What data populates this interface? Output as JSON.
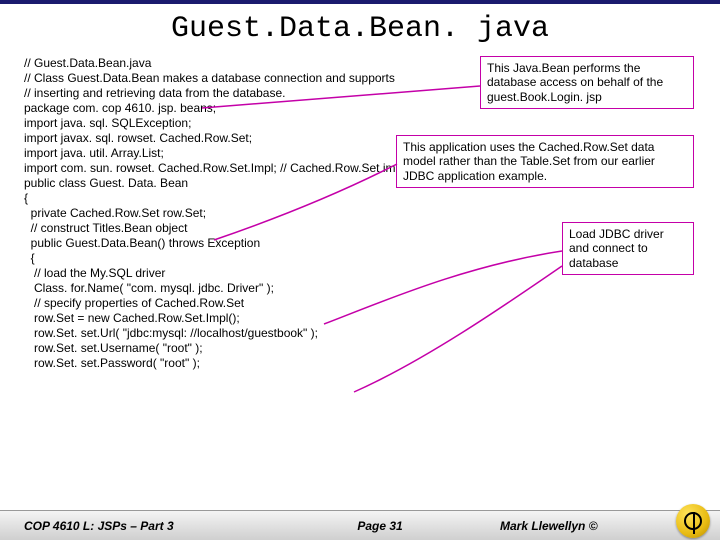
{
  "title": "Guest.Data.Bean. java",
  "code": {
    "l1": "// Guest.Data.Bean.java",
    "l2": "// Class Guest.Data.Bean makes a database connection and supports",
    "l3": "// inserting and retrieving data from the database.",
    "l4": "package com. cop 4610. jsp. beans;",
    "l5": "",
    "l6": "import java. sql. SQLException;",
    "l7": "import javax. sql. rowset. Cached.Row.Set;",
    "l8": "import java. util. Array.List;",
    "l9": "import com. sun. rowset. Cached.Row.Set.Impl; // Cached.Row.Set implementation",
    "l10": "",
    "l11": "public class Guest. Data. Bean",
    "l12": "{",
    "l13": "  private Cached.Row.Set row.Set;",
    "l14": "",
    "l15": "  // construct Titles.Bean object",
    "l16": "  public Guest.Data.Bean() throws Exception",
    "l17": "  {",
    "l18": "   // load the My.SQL driver",
    "l19": "   Class. for.Name( \"com. mysql. jdbc. Driver\" );",
    "l20": "",
    "l21": "   // specify properties of Cached.Row.Set",
    "l22": "   row.Set = new Cached.Row.Set.Impl();",
    "l23": "   row.Set. set.Url( \"jdbc:mysql: //localhost/guestbook\" );",
    "l24": "   row.Set. set.Username( \"root\" );",
    "l25": "   row.Set. set.Password( \"root\" );"
  },
  "callouts": {
    "c1": "This Java.Bean performs the database access on behalf of the guest.Book.Login. jsp",
    "c2": "This application uses the Cached.Row.Set data model rather than the Table.Set from our earlier JDBC application example.",
    "c3": "Load JDBC driver and connect to database"
  },
  "footer": {
    "left": "COP 4610 L: JSPs – Part 3",
    "center": "Page 31",
    "right": "Mark Llewellyn ©"
  }
}
